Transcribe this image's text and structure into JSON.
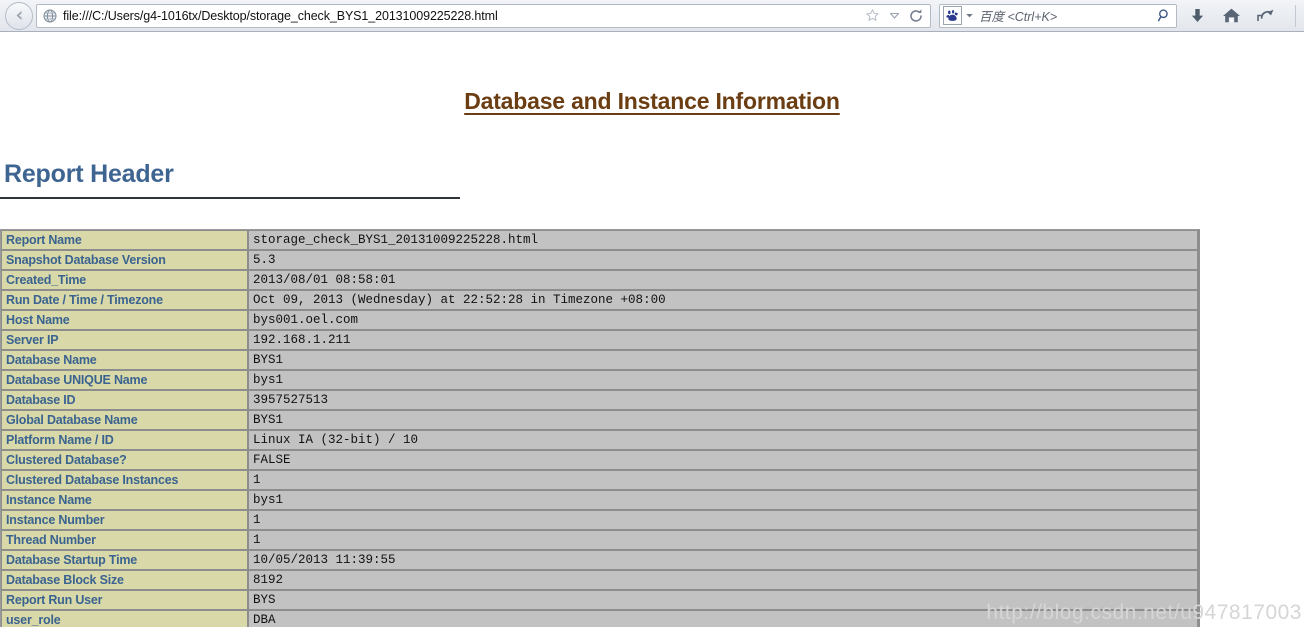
{
  "browser": {
    "back_icon": "back-arrow-icon",
    "favicon": "globe-icon",
    "url": "file:///C:/Users/g4-1016tx/Desktop/storage_check_BYS1_20131009225228.html",
    "bookmark_icon": "star-icon",
    "dropdown_icon": "chevron-down-icon",
    "reload_icon": "reload-icon",
    "search_engine_icon": "baidu-paw-icon",
    "search_placeholder": "百度 <Ctrl+K>",
    "search_submit_icon": "magnifier-icon",
    "downloads_icon": "download-arrow-icon",
    "home_icon": "home-icon",
    "restore_icon": "restore-session-icon"
  },
  "page": {
    "title": "Database and Instance Information",
    "section_title": "Report Header",
    "watermark": "http://blog.csdn.net/u947817003",
    "colors": {
      "title": "#6b3d12",
      "section_title": "#3e6491",
      "label_bg": "#d8d8a8",
      "label_text": "#3a6390",
      "value_bg": "#c2c2c2",
      "border": "#8d8d8d"
    },
    "rows": [
      {
        "label": "Report Name",
        "value": "storage_check_BYS1_20131009225228.html"
      },
      {
        "label": "Snapshot Database Version",
        "value": "5.3"
      },
      {
        "label": "Created_Time",
        "value": "2013/08/01 08:58:01"
      },
      {
        "label": "Run Date / Time / Timezone",
        "value": "Oct 09, 2013 (Wednesday) at 22:52:28 in Timezone +08:00"
      },
      {
        "label": "Host Name",
        "value": "bys001.oel.com"
      },
      {
        "label": "Server IP",
        "value": "192.168.1.211"
      },
      {
        "label": "Database Name",
        "value": "BYS1"
      },
      {
        "label": "Database UNIQUE Name",
        "value": "bys1"
      },
      {
        "label": "Database ID",
        "value": "3957527513"
      },
      {
        "label": "Global Database Name",
        "value": "BYS1"
      },
      {
        "label": "Platform Name / ID",
        "value": "Linux IA (32-bit) / 10"
      },
      {
        "label": "Clustered Database?",
        "value": "FALSE"
      },
      {
        "label": "Clustered Database Instances",
        "value": "1"
      },
      {
        "label": "Instance Name",
        "value": "bys1"
      },
      {
        "label": "Instance Number",
        "value": "1"
      },
      {
        "label": "Thread Number",
        "value": "1"
      },
      {
        "label": "Database Startup Time",
        "value": "10/05/2013 11:39:55"
      },
      {
        "label": "Database Block Size",
        "value": "8192"
      },
      {
        "label": "Report Run User",
        "value": "BYS"
      },
      {
        "label": "user_role",
        "value": "DBA"
      }
    ]
  }
}
